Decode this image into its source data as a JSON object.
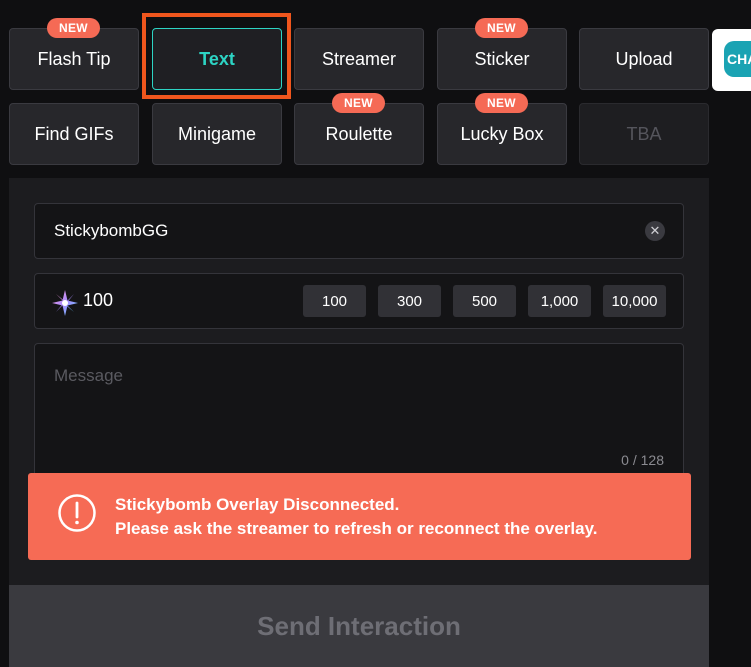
{
  "tabs": {
    "row1": [
      {
        "label": "Flash Tip",
        "badge": "NEW"
      },
      {
        "label": "Text",
        "badge": ""
      },
      {
        "label": "Streamer",
        "badge": ""
      },
      {
        "label": "Sticker",
        "badge": "NEW"
      },
      {
        "label": "Upload",
        "badge": ""
      }
    ],
    "row2": [
      {
        "label": "Find GIFs",
        "badge": ""
      },
      {
        "label": "Minigame",
        "badge": ""
      },
      {
        "label": "Roulette",
        "badge": "NEW"
      },
      {
        "label": "Lucky Box",
        "badge": "NEW"
      },
      {
        "label": "TBA",
        "badge": ""
      }
    ],
    "active": "Text"
  },
  "side_logo": {
    "text": "CHA"
  },
  "form": {
    "name_value": "StickybombGG",
    "amount_value": "100",
    "amount_presets": [
      "100",
      "300",
      "500",
      "1,000",
      "10,000"
    ],
    "message_placeholder": "Message",
    "message_counter": "0 / 128"
  },
  "alert": {
    "title": "Stickybomb Overlay Disconnected.",
    "message": "Please ask the streamer to refresh or reconnect the overlay."
  },
  "send_button": {
    "label": "Send Interaction"
  },
  "colors": {
    "accent": "#2dd4c4",
    "highlight_border": "#f0561d",
    "badge": "#f56a55",
    "alert_bg": "#f66b55",
    "panel_bg": "#1c1c1f"
  },
  "icons": {
    "clear": "close-icon",
    "currency": "sparkle-icon",
    "alert": "exclamation-circle-icon"
  }
}
